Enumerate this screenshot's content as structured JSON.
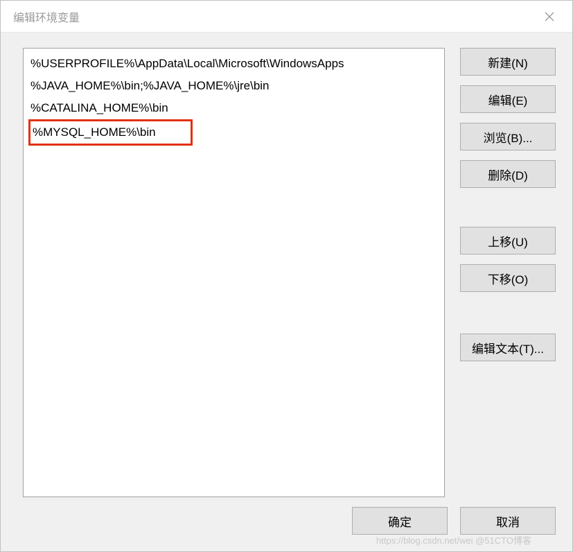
{
  "window": {
    "title": "编辑环境变量"
  },
  "list": {
    "items": [
      {
        "text": "%USERPROFILE%\\AppData\\Local\\Microsoft\\WindowsApps",
        "highlighted": false
      },
      {
        "text": "%JAVA_HOME%\\bin;%JAVA_HOME%\\jre\\bin",
        "highlighted": false
      },
      {
        "text": "%CATALINA_HOME%\\bin",
        "highlighted": false
      },
      {
        "text": "%MYSQL_HOME%\\bin",
        "highlighted": true
      }
    ]
  },
  "buttons": {
    "new": "新建(N)",
    "edit": "编辑(E)",
    "browse": "浏览(B)...",
    "delete": "删除(D)",
    "moveUp": "上移(U)",
    "moveDown": "下移(O)",
    "editText": "编辑文本(T)...",
    "ok": "确定",
    "cancel": "取消"
  },
  "watermark": "https://blog.csdn.net/wei @51CTO博客"
}
